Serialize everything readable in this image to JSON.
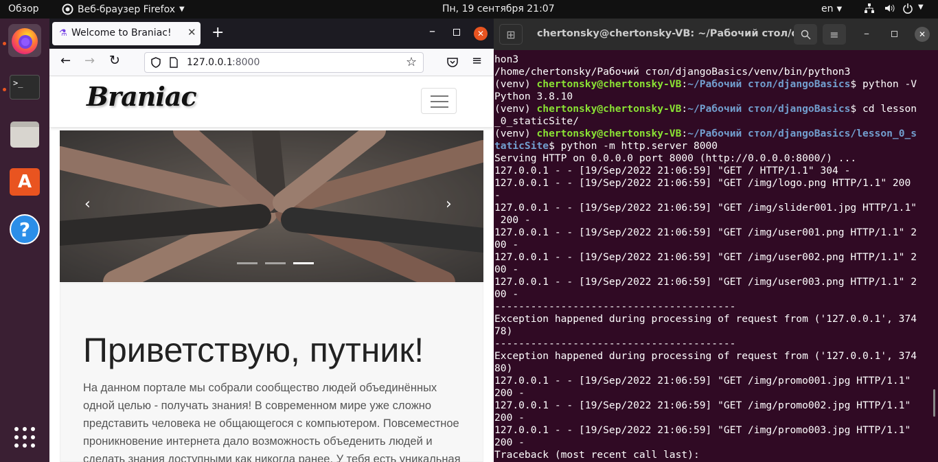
{
  "topbar": {
    "activities": "Обзор",
    "app_menu": "Веб-браузер Firefox",
    "clock": "Пн, 19 сентября  21:07",
    "lang": "en"
  },
  "firefox": {
    "tab_title": "Welcome to Braniac!",
    "url_host": "127.0.0.1",
    "url_port": ":8000"
  },
  "site": {
    "logo": "Braniac",
    "heading": "Приветствую, путник!",
    "intro": "На данном портале мы собрали сообщество людей объединённых одной целью - получать знания! В современном мире уже сложно представить человека не общающегося с компьютером. Повсеместное проникновение интернета дало возможность объеденить людей и сделать знания доступными как никогда ранее. У тебя есть уникальная",
    "slider_indicators": 3,
    "slider_active": 3
  },
  "terminal": {
    "title": "chertonsky@chertonsky-VB: ~/Рабочий стол/dj...",
    "lines": [
      [
        {
          "t": "hon3"
        }
      ],
      [
        {
          "t": "/home/chertonsky/Рабочий стол/djangoBasics/venv/bin/python3"
        }
      ],
      [
        {
          "t": "(venv) "
        },
        {
          "t": "chertonsky@chertonsky-VB",
          "c": "g"
        },
        {
          "t": ":"
        },
        {
          "t": "~/Рабочий стол/djangoBasics",
          "c": "b"
        },
        {
          "t": "$ python -V"
        }
      ],
      [
        {
          "t": "Python 3.8.10"
        }
      ],
      [
        {
          "t": "(venv) "
        },
        {
          "t": "chertonsky@chertonsky-VB",
          "c": "g"
        },
        {
          "t": ":"
        },
        {
          "t": "~/Рабочий стол/djangoBasics",
          "c": "b"
        },
        {
          "t": "$ cd lesson"
        }
      ],
      [
        {
          "t": "_0_staticSite/"
        }
      ],
      [
        {
          "t": "(venv) "
        },
        {
          "t": "chertonsky@chertonsky-VB",
          "c": "g"
        },
        {
          "t": ":"
        },
        {
          "t": "~/Рабочий стол/djangoBasics/lesson_0_s",
          "c": "b"
        }
      ],
      [
        {
          "t": "taticSite",
          "c": "b"
        },
        {
          "t": "$ python -m http.server 8000"
        }
      ],
      [
        {
          "t": "Serving HTTP on 0.0.0.0 port 8000 (http://0.0.0.0:8000/) ..."
        }
      ],
      [
        {
          "t": "127.0.0.1 - - [19/Sep/2022 21:06:59] \"GET / HTTP/1.1\" 304 -"
        }
      ],
      [
        {
          "t": "127.0.0.1 - - [19/Sep/2022 21:06:59] \"GET /img/logo.png HTTP/1.1\" 200"
        }
      ],
      [
        {
          "t": "-"
        }
      ],
      [
        {
          "t": "127.0.0.1 - - [19/Sep/2022 21:06:59] \"GET /img/slider001.jpg HTTP/1.1\""
        }
      ],
      [
        {
          "t": " 200 -"
        }
      ],
      [
        {
          "t": "127.0.0.1 - - [19/Sep/2022 21:06:59] \"GET /img/user001.png HTTP/1.1\" 2"
        }
      ],
      [
        {
          "t": "00 -"
        }
      ],
      [
        {
          "t": "127.0.0.1 - - [19/Sep/2022 21:06:59] \"GET /img/user002.png HTTP/1.1\" 2"
        }
      ],
      [
        {
          "t": "00 -"
        }
      ],
      [
        {
          "t": "127.0.0.1 - - [19/Sep/2022 21:06:59] \"GET /img/user003.png HTTP/1.1\" 2"
        }
      ],
      [
        {
          "t": "00 -"
        }
      ],
      [
        {
          "t": "----------------------------------------"
        }
      ],
      [
        {
          "t": "Exception happened during processing of request from ('127.0.0.1', 374"
        }
      ],
      [
        {
          "t": "78)"
        }
      ],
      [
        {
          "t": "----------------------------------------"
        }
      ],
      [
        {
          "t": "Exception happened during processing of request from ('127.0.0.1', 374"
        }
      ],
      [
        {
          "t": "80)"
        }
      ],
      [
        {
          "t": "127.0.0.1 - - [19/Sep/2022 21:06:59] \"GET /img/promo001.jpg HTTP/1.1\""
        }
      ],
      [
        {
          "t": "200 -"
        }
      ],
      [
        {
          "t": "127.0.0.1 - - [19/Sep/2022 21:06:59] \"GET /img/promo002.jpg HTTP/1.1\""
        }
      ],
      [
        {
          "t": "200 -"
        }
      ],
      [
        {
          "t": "127.0.0.1 - - [19/Sep/2022 21:06:59] \"GET /img/promo003.jpg HTTP/1.1\""
        }
      ],
      [
        {
          "t": "200 -"
        }
      ],
      [
        {
          "t": "Traceback (most recent call last):"
        }
      ]
    ]
  }
}
